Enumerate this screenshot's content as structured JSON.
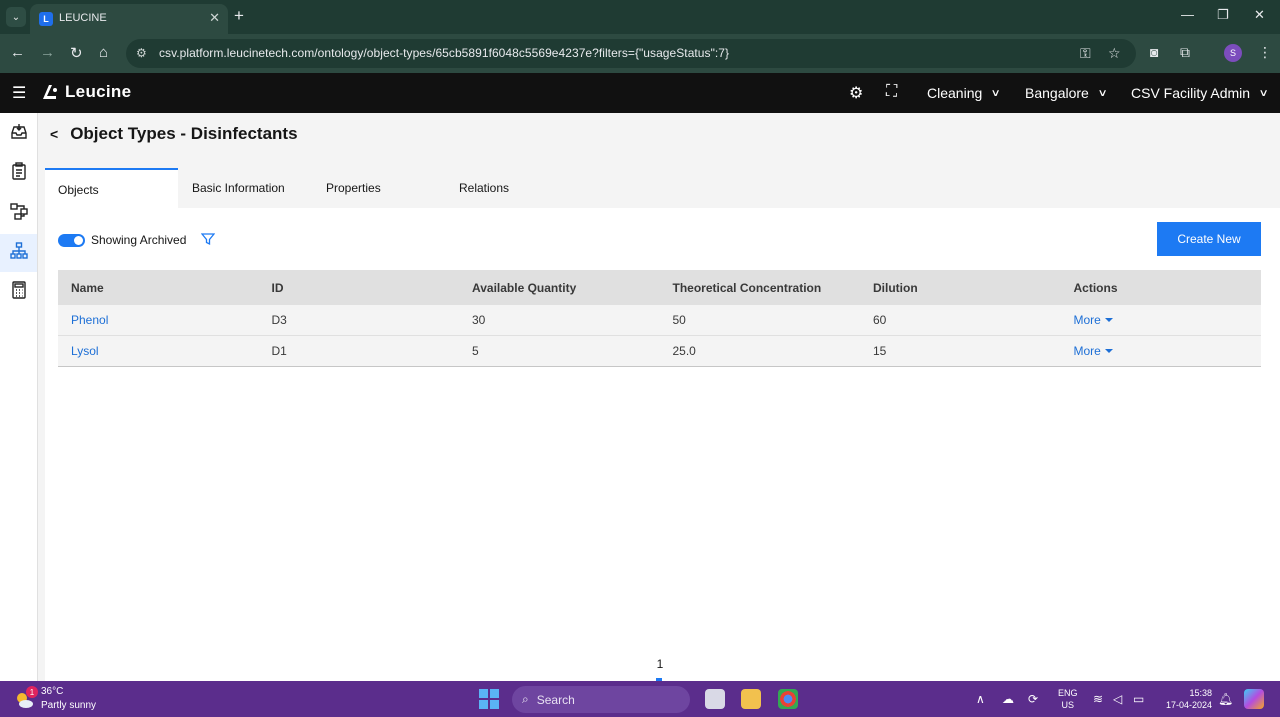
{
  "browser": {
    "tab_title": "LEUCINE",
    "tab_favicon": "L",
    "url": "csv.platform.leucinetech.com/ontology/object-types/65cb5891f6048c5569e4237e?filters={\"usageStatus\":7}",
    "profile_initial": "S"
  },
  "app": {
    "brand": "Leucine",
    "header": {
      "use_case": "Cleaning",
      "facility": "Bangalore",
      "role": "CSV Facility Admin"
    }
  },
  "page": {
    "title": "Object Types - Disinfectants",
    "tabs": [
      {
        "label": "Objects"
      },
      {
        "label": "Basic Information"
      },
      {
        "label": "Properties"
      },
      {
        "label": "Relations"
      }
    ],
    "toggle_label": "Showing Archived",
    "toggle_on": true,
    "create_button": "Create New",
    "table": {
      "columns": [
        "Name",
        "ID",
        "Available Quantity",
        "Theoretical Concentration",
        "Dilution",
        "Actions"
      ],
      "rows": [
        {
          "name": "Phenol",
          "id": "D3",
          "qty": "30",
          "conc": "50",
          "dilution": "60",
          "action": "More"
        },
        {
          "name": "Lysol",
          "id": "D1",
          "qty": "5",
          "conc": "25.0",
          "dilution": "15",
          "action": "More"
        }
      ]
    },
    "page_number": "1"
  },
  "taskbar": {
    "temperature": "36°C",
    "weather": "Partly sunny",
    "weather_badge": "1",
    "search_placeholder": "Search",
    "lang_line1": "ENG",
    "lang_line2": "US",
    "time": "15:38",
    "date": "17-04-2024"
  },
  "colors": {
    "accent": "#1d7af3",
    "header_bg": "#111111",
    "browser_chrome": "#2d4a41",
    "taskbar": "#5b2d8c"
  }
}
